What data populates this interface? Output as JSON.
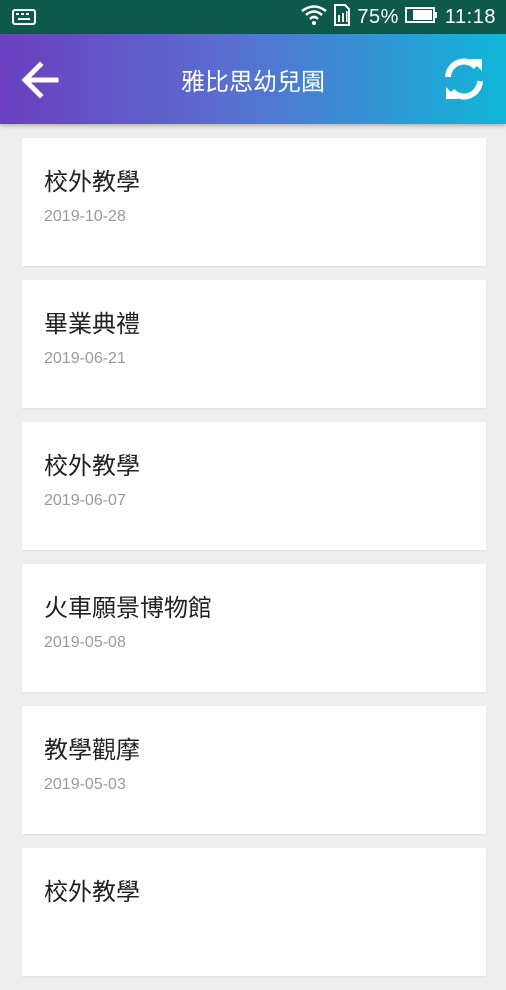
{
  "status_bar": {
    "battery": "75%",
    "time": "11:18",
    "icons": [
      "keyboard-icon",
      "wifi-icon",
      "sim-icon",
      "battery-icon"
    ]
  },
  "app_bar": {
    "title": "雅比思幼兒園",
    "back_icon": "arrow-left-icon",
    "refresh_icon": "refresh-icon"
  },
  "items": [
    {
      "title": "校外教學",
      "date": "2019-10-28"
    },
    {
      "title": "畢業典禮",
      "date": "2019-06-21"
    },
    {
      "title": "校外教學",
      "date": "2019-06-07"
    },
    {
      "title": "火車願景博物館",
      "date": "2019-05-08"
    },
    {
      "title": "教學觀摩",
      "date": "2019-05-03"
    },
    {
      "title": "校外教學",
      "date": ""
    }
  ],
  "colors": {
    "status_bar": "#0e5a4a",
    "app_bar_start": "#6a3fbf",
    "app_bar_end": "#0fb6d8",
    "background": "#eeeeee"
  }
}
